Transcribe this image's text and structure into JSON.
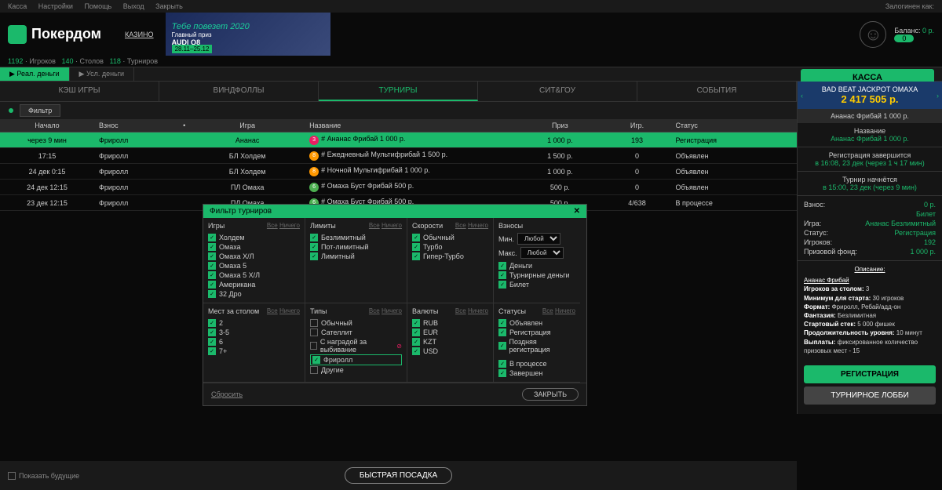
{
  "topbar": {
    "links": [
      "Касса",
      "Настройки",
      "Помощь",
      "Выход",
      "Закрыть"
    ],
    "logged_as": "Залогинен как:"
  },
  "brand": "Покердом",
  "casino": "КАЗИНО",
  "banner": {
    "title": "Тебе повезет 2020",
    "sub": "Главный приз",
    "brand": "AUDI Q8",
    "dates": "28.11–25.12"
  },
  "balance_label": "Баланс:",
  "balance_value": "0 р.",
  "balance_pill": "0",
  "stats": {
    "players_n": "1192",
    "players": "Игроков",
    "tables_n": "140",
    "tables": "Столов",
    "tourn_n": "118",
    "tourn": "Турниров"
  },
  "money_tabs": [
    "Реал. деньги",
    "Усл. деньги"
  ],
  "kassa": "КАССА",
  "game_tabs": [
    "КЭШ ИГРЫ",
    "ВИНДФОЛЛЫ",
    "ТУРНИРЫ",
    "СИТ&ГОУ",
    "СОБЫТИЯ"
  ],
  "filter_label": "Фильтр",
  "cols": [
    "Начало",
    "Взнос",
    "Игра",
    "Название",
    "Приз",
    "Игр.",
    "Статус"
  ],
  "rows": [
    {
      "start": "через 9 мин",
      "buyin": "Фриролл",
      "game": "Ананас",
      "badge": "3",
      "bc": "b3",
      "name": "Ананас Фрибай 1 000 р.",
      "prize": "1 000 р.",
      "pl": "193",
      "st": "Регистрация",
      "sel": true
    },
    {
      "start": "17:15",
      "buyin": "Фриролл",
      "game": "БЛ Холдем",
      "badge": "8",
      "bc": "b8",
      "name": "Ежедневный Мультифрибай 1 500 р.",
      "prize": "1 500 р.",
      "pl": "0",
      "st": "Объявлен"
    },
    {
      "start": "24 дек 0:15",
      "buyin": "Фриролл",
      "game": "БЛ Холдем",
      "badge": "8",
      "bc": "b8",
      "name": "Ночной Мультифрибай 1 000 р.",
      "prize": "1 000 р.",
      "pl": "0",
      "st": "Объявлен"
    },
    {
      "start": "24 дек 12:15",
      "buyin": "Фриролл",
      "game": "ПЛ Омаха",
      "badge": "6",
      "bc": "b6",
      "name": "Омаха Буст Фрибай 500 р.",
      "prize": "500 р.",
      "pl": "0",
      "st": "Объявлен"
    },
    {
      "start": "23 дек 12:15",
      "buyin": "Фриролл",
      "game": "ПЛ Омаха",
      "badge": "6",
      "bc": "b6",
      "name": "Омаха Буст Фрибай 500 р.",
      "prize": "500 р.",
      "pl": "4/638",
      "st": "В процессе"
    }
  ],
  "jackpot": {
    "title": "BAD BEAT JACKPOT ОМАХА",
    "amount": "2 417 505 р."
  },
  "sb": {
    "title": "Ананас Фрибай 1 000 р.",
    "name_l": "Название",
    "name_v": "Ананас Фрибай 1 000 р.",
    "reg_end_l": "Регистрация завершится",
    "reg_end_v": "в 16:08, 23 дек (через 1 ч 17 мин)",
    "start_l": "Турнир начнётся",
    "start_v": "в 15:00, 23 дек (через 9 мин)",
    "rows": [
      [
        "Взнос:",
        "0 р."
      ],
      [
        "",
        "Билет"
      ],
      [
        "Игра:",
        "Ананас Безлимитный"
      ],
      [
        "Статус:",
        "Регистрация"
      ],
      [
        "Игроков:",
        "192"
      ],
      [
        "Призовой фонд:",
        "1 000 р."
      ]
    ],
    "desc_title": "Описание:",
    "desc_name": "Ананас Фрибай",
    "desc": [
      [
        "Игроков за столом:",
        " 3"
      ],
      [
        "Минимум для старта:",
        " 30 игроков"
      ],
      [
        "Формат:",
        " Фриролл, Ребай/адд-он"
      ],
      [
        "Фантазия:",
        " Безлимитная"
      ],
      [
        "Стартовый стек:",
        " 5 000 фишек"
      ],
      [
        "Продолжительность уровня:",
        " 10 минут"
      ],
      [
        "Выплаты:",
        " фиксированное количество призовых мест - 15"
      ]
    ],
    "btn_reg": "РЕГИСТРАЦИЯ",
    "btn_lobby": "ТУРНИРНОЕ ЛОББИ"
  },
  "show_future": "Показать будущие",
  "fast_seat": "БЫСТРАЯ ПОСАДКА",
  "modal": {
    "title": "Фильтр турниров",
    "all": "Все",
    "none": "Ничего",
    "games_h": "Игры",
    "games": [
      "Холдем",
      "Омаха",
      "Омаха Х/Л",
      "Омаха 5",
      "Омаха 5 Х/Л",
      "Американа",
      "32 Дро"
    ],
    "limits_h": "Лимиты",
    "limits": [
      "Безлимитный",
      "Пот-лимитный",
      "Лимитный"
    ],
    "speeds_h": "Скорости",
    "speeds": [
      "Обычный",
      "Турбо",
      "Гипер-Турбо"
    ],
    "stakes_h": "Взносы",
    "min": "Мин.",
    "max": "Макс.",
    "any": "Любой",
    "stakes_opts": [
      "Деньги",
      "Турнирные деньги",
      "Билет"
    ],
    "seats_h": "Мест за столом",
    "seats": [
      "2",
      "3-5",
      "6",
      "7+"
    ],
    "types_h": "Типы",
    "types": [
      {
        "l": "Обычный",
        "on": false
      },
      {
        "l": "Сателлит",
        "on": false
      },
      {
        "l": "С наградой за выбивание",
        "on": false,
        "icon": true
      },
      {
        "l": "Фриролл",
        "on": true,
        "hl": true
      },
      {
        "l": "Другие",
        "on": false
      }
    ],
    "curr_h": "Валюты",
    "curr": [
      "RUB",
      "EUR",
      "KZT",
      "USD"
    ],
    "status_h": "Статусы",
    "status": [
      "Объявлен",
      "Регистрация",
      "Поздняя регистрация"
    ],
    "status2": [
      "В процессе",
      "Завершен"
    ],
    "reset": "Сбросить",
    "close": "ЗАКРЫТЬ"
  }
}
